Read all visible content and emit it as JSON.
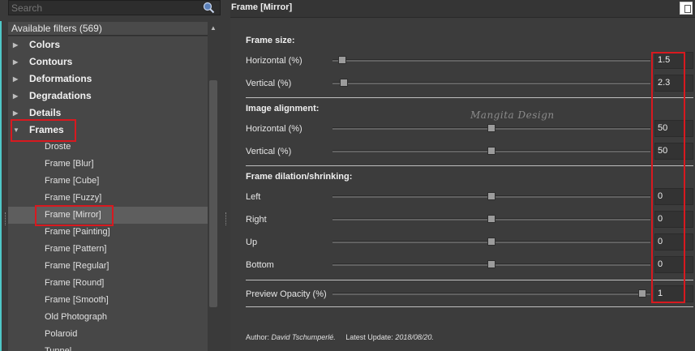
{
  "search": {
    "placeholder": "Search"
  },
  "filters_header": "Available filters (569)",
  "tree": {
    "categories": [
      {
        "label": "Colors",
        "expanded": false
      },
      {
        "label": "Contours",
        "expanded": false
      },
      {
        "label": "Deformations",
        "expanded": false
      },
      {
        "label": "Degradations",
        "expanded": false
      },
      {
        "label": "Details",
        "expanded": false
      },
      {
        "label": "Frames",
        "expanded": true
      }
    ],
    "frame_items": [
      "Droste",
      "Frame [Blur]",
      "Frame [Cube]",
      "Frame [Fuzzy]",
      "Frame [Mirror]",
      "Frame [Painting]",
      "Frame [Pattern]",
      "Frame [Regular]",
      "Frame [Round]",
      "Frame [Smooth]",
      "Old Photograph",
      "Polaroid",
      "Tunnel"
    ],
    "selected": "Frame [Mirror]"
  },
  "panel": {
    "title": "Frame [Mirror]",
    "sections": {
      "frame_size": "Frame size:",
      "image_alignment": "Image alignment:",
      "frame_dilation": "Frame dilation/shrinking:"
    },
    "params": {
      "fs_horizontal": {
        "label": "Horizontal (%)",
        "value": "1.5",
        "fraction": 0.03
      },
      "fs_vertical": {
        "label": "Vertical (%)",
        "value": "2.3",
        "fraction": 0.035
      },
      "ia_horizontal": {
        "label": "Horizontal (%)",
        "value": "50",
        "fraction": 0.5
      },
      "ia_vertical": {
        "label": "Vertical (%)",
        "value": "50",
        "fraction": 0.5
      },
      "left": {
        "label": "Left",
        "value": "0",
        "fraction": 0.5
      },
      "right": {
        "label": "Right",
        "value": "0",
        "fraction": 0.5
      },
      "up": {
        "label": "Up",
        "value": "0",
        "fraction": 0.5
      },
      "bottom": {
        "label": "Bottom",
        "value": "0",
        "fraction": 0.5
      },
      "preview_opacity": {
        "label": "Preview Opacity (%)",
        "value": "1",
        "fraction": 0.975
      }
    },
    "credits": {
      "author_label": "Author:",
      "author_name": "David Tschumperlé.",
      "update_label": "Latest Update:",
      "update_date": "2018/08/20."
    },
    "watermark": "Mangita Design"
  },
  "colors": {
    "highlight_red": "#d8191f",
    "accent_cyan": "#4fc8c8",
    "background": "#3c3c3c"
  },
  "icons": {
    "search": "search-icon",
    "window_toggle": "window-toggle-icon",
    "collapsed": "chevron-right-icon",
    "expanded": "chevron-down-icon"
  }
}
